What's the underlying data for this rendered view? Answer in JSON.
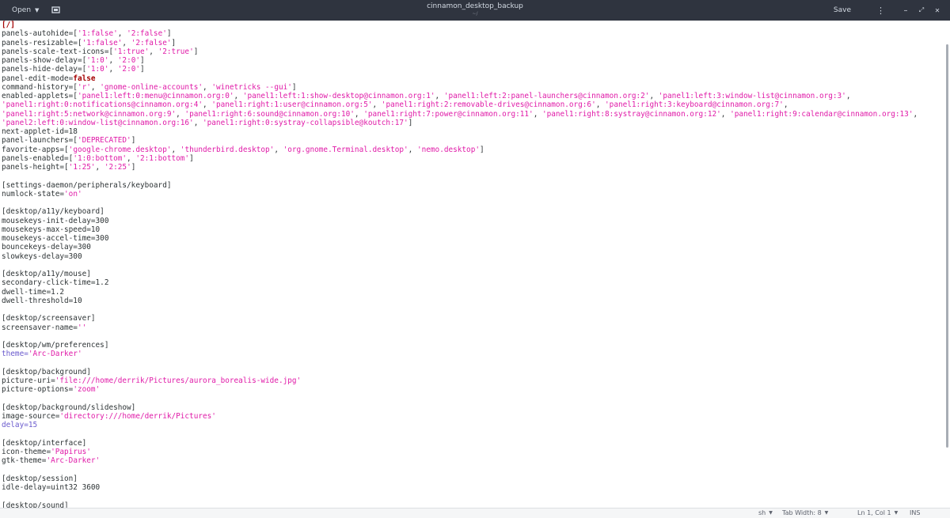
{
  "header": {
    "open_label": "Open",
    "title": "cinnamon_desktop_backup",
    "subtitle": "~/",
    "save_label": "Save",
    "menu_glyph": "⋮",
    "minimize_glyph": "–",
    "restore_glyph": "⤢",
    "close_glyph": "✕",
    "colors": {
      "headerbar": "#2f343f",
      "text": "#d3dae3"
    }
  },
  "editor": {
    "highlight_colors": {
      "string": "#e01ba8",
      "boolean": "#a40000",
      "identifier": "#6a5acd"
    },
    "lines": [
      [
        {
          "t": "[/]",
          "c": "kw"
        }
      ],
      [
        {
          "t": "panels-autohide=["
        },
        {
          "t": "'1:false'",
          "c": "s"
        },
        {
          "t": ", "
        },
        {
          "t": "'2:false'",
          "c": "s"
        },
        {
          "t": "]"
        }
      ],
      [
        {
          "t": "panels-resizable=["
        },
        {
          "t": "'1:false'",
          "c": "s"
        },
        {
          "t": ", "
        },
        {
          "t": "'2:false'",
          "c": "s"
        },
        {
          "t": "]"
        }
      ],
      [
        {
          "t": "panels-scale-text-icons=["
        },
        {
          "t": "'1:true'",
          "c": "s"
        },
        {
          "t": ", "
        },
        {
          "t": "'2:true'",
          "c": "s"
        },
        {
          "t": "]"
        }
      ],
      [
        {
          "t": "panels-show-delay=["
        },
        {
          "t": "'1:0'",
          "c": "s"
        },
        {
          "t": ", "
        },
        {
          "t": "'2:0'",
          "c": "s"
        },
        {
          "t": "]"
        }
      ],
      [
        {
          "t": "panels-hide-delay=["
        },
        {
          "t": "'1:0'",
          "c": "s"
        },
        {
          "t": ", "
        },
        {
          "t": "'2:0'",
          "c": "s"
        },
        {
          "t": "]"
        }
      ],
      [
        {
          "t": "panel-edit-mode="
        },
        {
          "t": "false",
          "c": "kw"
        }
      ],
      [
        {
          "t": "command-history=["
        },
        {
          "t": "'r'",
          "c": "s"
        },
        {
          "t": ", "
        },
        {
          "t": "'gnome-online-accounts'",
          "c": "s"
        },
        {
          "t": ", "
        },
        {
          "t": "'winetricks --gui'",
          "c": "s"
        },
        {
          "t": "]"
        }
      ],
      [
        {
          "t": "enabled-applets=["
        },
        {
          "t": "'panel1:left:0:menu@cinnamon.org:0'",
          "c": "s"
        },
        {
          "t": ", "
        },
        {
          "t": "'panel1:left:1:show-desktop@cinnamon.org:1'",
          "c": "s"
        },
        {
          "t": ", "
        },
        {
          "t": "'panel1:left:2:panel-launchers@cinnamon.org:2'",
          "c": "s"
        },
        {
          "t": ", "
        },
        {
          "t": "'panel1:left:3:window-list@cinnamon.org:3'",
          "c": "s"
        },
        {
          "t": ","
        }
      ],
      [
        {
          "t": "'panel1:right:0:notifications@cinnamon.org:4'",
          "c": "s"
        },
        {
          "t": ", "
        },
        {
          "t": "'panel1:right:1:user@cinnamon.org:5'",
          "c": "s"
        },
        {
          "t": ", "
        },
        {
          "t": "'panel1:right:2:removable-drives@cinnamon.org:6'",
          "c": "s"
        },
        {
          "t": ", "
        },
        {
          "t": "'panel1:right:3:keyboard@cinnamon.org:7'",
          "c": "s"
        },
        {
          "t": ","
        }
      ],
      [
        {
          "t": "'panel1:right:5:network@cinnamon.org:9'",
          "c": "s"
        },
        {
          "t": ", "
        },
        {
          "t": "'panel1:right:6:sound@cinnamon.org:10'",
          "c": "s"
        },
        {
          "t": ", "
        },
        {
          "t": "'panel1:right:7:power@cinnamon.org:11'",
          "c": "s"
        },
        {
          "t": ", "
        },
        {
          "t": "'panel1:right:8:systray@cinnamon.org:12'",
          "c": "s"
        },
        {
          "t": ", "
        },
        {
          "t": "'panel1:right:9:calendar@cinnamon.org:13'",
          "c": "s"
        },
        {
          "t": ","
        }
      ],
      [
        {
          "t": "'panel2:left:0:window-list@cinnamon.org:16'",
          "c": "s"
        },
        {
          "t": ", "
        },
        {
          "t": "'panel1:right:0:systray-collapsible@koutch:17'",
          "c": "s"
        },
        {
          "t": "]"
        }
      ],
      [
        {
          "t": "next-applet-id=18"
        }
      ],
      [
        {
          "t": "panel-launchers=["
        },
        {
          "t": "'DEPRECATED'",
          "c": "s"
        },
        {
          "t": "]"
        }
      ],
      [
        {
          "t": "favorite-apps=["
        },
        {
          "t": "'google-chrome.desktop'",
          "c": "s"
        },
        {
          "t": ", "
        },
        {
          "t": "'thunderbird.desktop'",
          "c": "s"
        },
        {
          "t": ", "
        },
        {
          "t": "'org.gnome.Terminal.desktop'",
          "c": "s"
        },
        {
          "t": ", "
        },
        {
          "t": "'nemo.desktop'",
          "c": "s"
        },
        {
          "t": "]"
        }
      ],
      [
        {
          "t": "panels-enabled=["
        },
        {
          "t": "'1:0:bottom'",
          "c": "s"
        },
        {
          "t": ", "
        },
        {
          "t": "'2:1:bottom'",
          "c": "s"
        },
        {
          "t": "]"
        }
      ],
      [
        {
          "t": "panels-height=["
        },
        {
          "t": "'1:25'",
          "c": "s"
        },
        {
          "t": ", "
        },
        {
          "t": "'2:25'",
          "c": "s"
        },
        {
          "t": "]"
        }
      ],
      [
        {
          "t": ""
        }
      ],
      [
        {
          "t": "[settings-daemon/peripherals/keyboard]"
        }
      ],
      [
        {
          "t": "numlock-state="
        },
        {
          "t": "'on'",
          "c": "s"
        }
      ],
      [
        {
          "t": ""
        }
      ],
      [
        {
          "t": "[desktop/a11y/keyboard]"
        }
      ],
      [
        {
          "t": "mousekeys-init-delay=300"
        }
      ],
      [
        {
          "t": "mousekeys-max-speed=10"
        }
      ],
      [
        {
          "t": "mousekeys-accel-time=300"
        }
      ],
      [
        {
          "t": "bouncekeys-delay=300"
        }
      ],
      [
        {
          "t": "slowkeys-delay=300"
        }
      ],
      [
        {
          "t": ""
        }
      ],
      [
        {
          "t": "[desktop/a11y/mouse]"
        }
      ],
      [
        {
          "t": "secondary-click-time=1.2"
        }
      ],
      [
        {
          "t": "dwell-time=1.2"
        }
      ],
      [
        {
          "t": "dwell-threshold=10"
        }
      ],
      [
        {
          "t": ""
        }
      ],
      [
        {
          "t": "[desktop/screensaver]"
        }
      ],
      [
        {
          "t": "screensaver-name="
        },
        {
          "t": "''",
          "c": "s"
        }
      ],
      [
        {
          "t": ""
        }
      ],
      [
        {
          "t": "[desktop/wm/preferences]"
        }
      ],
      [
        {
          "t": "theme=",
          "c": "idf"
        },
        {
          "t": "'Arc-Darker'",
          "c": "s"
        }
      ],
      [
        {
          "t": ""
        }
      ],
      [
        {
          "t": "[desktop/background]"
        }
      ],
      [
        {
          "t": "picture-uri="
        },
        {
          "t": "'file:///home/derrik/Pictures/aurora_borealis-wide.jpg'",
          "c": "s"
        }
      ],
      [
        {
          "t": "picture-options="
        },
        {
          "t": "'zoom'",
          "c": "s"
        }
      ],
      [
        {
          "t": ""
        }
      ],
      [
        {
          "t": "[desktop/background/slideshow]"
        }
      ],
      [
        {
          "t": "image-source="
        },
        {
          "t": "'directory:///home/derrik/Pictures'",
          "c": "s"
        }
      ],
      [
        {
          "t": "delay=15",
          "c": "idf"
        }
      ],
      [
        {
          "t": ""
        }
      ],
      [
        {
          "t": "[desktop/interface]"
        }
      ],
      [
        {
          "t": "icon-theme="
        },
        {
          "t": "'Papirus'",
          "c": "s"
        }
      ],
      [
        {
          "t": "gtk-theme="
        },
        {
          "t": "'Arc-Darker'",
          "c": "s"
        }
      ],
      [
        {
          "t": ""
        }
      ],
      [
        {
          "t": "[desktop/session]"
        }
      ],
      [
        {
          "t": "idle-delay=uint32 3600"
        }
      ],
      [
        {
          "t": ""
        }
      ],
      [
        {
          "t": "[desktop/sound]"
        }
      ]
    ]
  },
  "statusbar": {
    "language": "sh",
    "tab_width": "Tab Width: 8",
    "position": "Ln 1, Col 1",
    "mode": "INS"
  }
}
